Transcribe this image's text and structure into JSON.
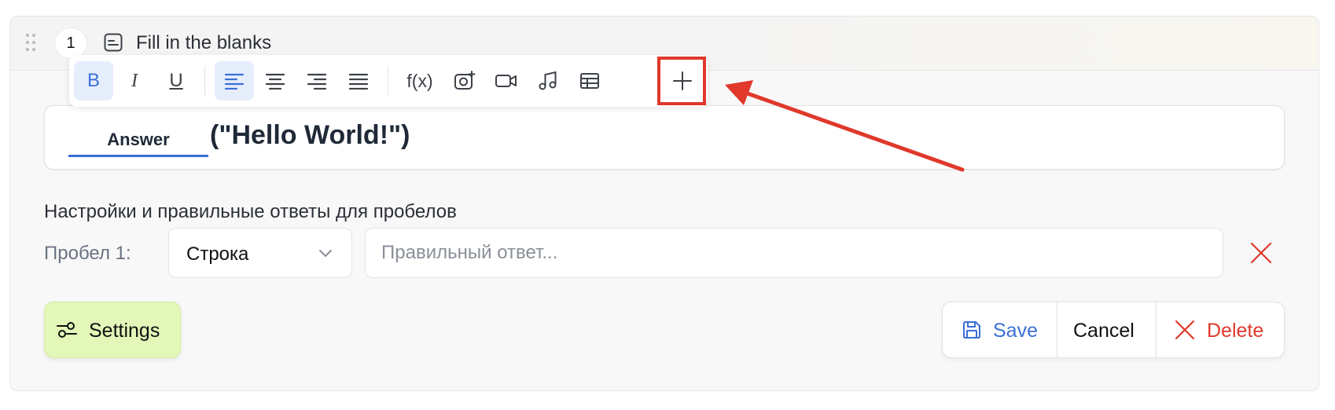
{
  "question": {
    "number": "1",
    "type_icon": "fill-blank-icon",
    "title": "Fill in the blanks"
  },
  "toolbar": {
    "bold": "B",
    "italic": "I",
    "underline": "U",
    "formula": "f(x)",
    "active_buttons": [
      "bold",
      "align-left"
    ],
    "icons": [
      "align-left-icon",
      "align-center-icon",
      "align-right-icon",
      "align-justify-icon",
      "add-image-icon",
      "video-icon",
      "music-icon",
      "table-icon",
      "plus-icon"
    ]
  },
  "editor": {
    "blank_label": "Answer",
    "text": "(\"Hello World!\")"
  },
  "gaps": {
    "section_title": "Настройки и правильные ответы для пробелов",
    "items": [
      {
        "label": "Пробел 1:",
        "type_value": "Строка",
        "answer_value": "",
        "answer_placeholder": "Правильный ответ..."
      }
    ]
  },
  "footer": {
    "settings_label": "Settings",
    "save_label": "Save",
    "cancel_label": "Cancel",
    "delete_label": "Delete"
  },
  "colors": {
    "accent_blue": "#3b6fd8",
    "danger_red": "#e0382b",
    "settings_green": "#e3f7b8",
    "annotation_red": "#e0382b"
  }
}
